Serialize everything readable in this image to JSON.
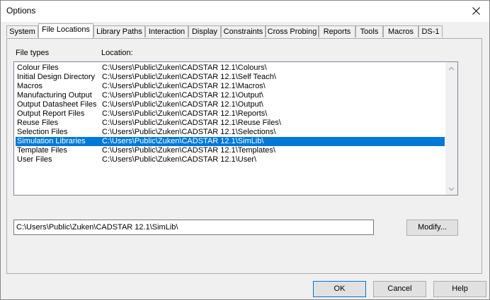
{
  "window": {
    "title": "Options"
  },
  "tabs": [
    "System",
    "File Locations",
    "Library Paths",
    "Interaction",
    "Display",
    "Constraints",
    "Cross Probing",
    "Reports",
    "Tools",
    "Macros",
    "DS-1"
  ],
  "active_tab": "File Locations",
  "list": {
    "headers": {
      "type": "File types",
      "location": "Location:"
    },
    "rows": [
      {
        "type": "Colour Files",
        "location": "C:\\Users\\Public\\Zuken\\CADSTAR 12.1\\Colours\\"
      },
      {
        "type": "Initial Design Directory",
        "location": "C:\\Users\\Public\\Zuken\\CADSTAR 12.1\\Self Teach\\"
      },
      {
        "type": "Macros",
        "location": "C:\\Users\\Public\\Zuken\\CADSTAR 12.1\\Macros\\"
      },
      {
        "type": "Manufacturing Output",
        "location": "C:\\Users\\Public\\Zuken\\CADSTAR 12.1\\Output\\"
      },
      {
        "type": "Output Datasheet Files",
        "location": "C:\\Users\\Public\\Zuken\\CADSTAR 12.1\\Output\\"
      },
      {
        "type": "Output Report Files",
        "location": "C:\\Users\\Public\\Zuken\\CADSTAR 12.1\\Reports\\"
      },
      {
        "type": "Reuse Files",
        "location": "C:\\Users\\Public\\Zuken\\CADSTAR 12.1\\Reuse Files\\"
      },
      {
        "type": "Selection Files",
        "location": "C:\\Users\\Public\\Zuken\\CADSTAR 12.1\\Selections\\"
      },
      {
        "type": "Simulation Libraries",
        "location": "C:\\Users\\Public\\Zuken\\CADSTAR 12.1\\SimLib\\"
      },
      {
        "type": "Template Files",
        "location": "C:\\Users\\Public\\Zuken\\CADSTAR 12.1\\Templates\\"
      },
      {
        "type": "User Files",
        "location": "C:\\Users\\Public\\Zuken\\CADSTAR 12.1\\User\\"
      }
    ],
    "selected": "Simulation Libraries"
  },
  "path_field": {
    "value": "C:\\Users\\Public\\Zuken\\CADSTAR 12.1\\SimLib\\"
  },
  "buttons": {
    "modify": "Modify...",
    "ok": "OK",
    "cancel": "Cancel",
    "help": "Help"
  },
  "colors": {
    "selection": "#0078d7",
    "default_button_border": "#0078d7"
  },
  "icons": {
    "close": "close-icon",
    "scroll_up": "scroll-up-arrow-icon",
    "scroll_down": "scroll-down-arrow-icon"
  }
}
